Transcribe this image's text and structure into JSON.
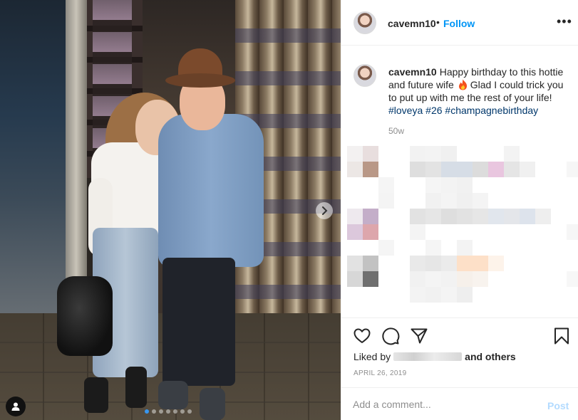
{
  "post": {
    "username": "cavemn10",
    "follow_label": "Follow",
    "separator": "•",
    "more_label": "•••",
    "caption_text_1": "Happy birthday to this hottie and future wife",
    "caption_text_2": "Glad I could trick you to put up with me the rest of your life!",
    "hashtags": [
      "#loveya",
      "#26",
      "#champagnebirthday"
    ],
    "age": "50w",
    "liked_by_prefix": "Liked by",
    "liked_by_suffix": "and others",
    "date": "APRIL 26, 2019",
    "comment_placeholder": "Add a comment...",
    "post_label": "Post",
    "carousel_slides": 7,
    "carousel_active": 1
  },
  "icons": {
    "next": "chevron-right-icon",
    "tag": "user-tag-icon",
    "like": "heart-icon",
    "comment": "comment-icon",
    "share": "paper-plane-icon",
    "save": "bookmark-icon",
    "emoji": "fire-emoji"
  },
  "colors": {
    "link_blue": "#0095f6",
    "hashtag": "#00376b",
    "muted": "#8e8e8e",
    "post_disabled": "#b3dbff"
  }
}
